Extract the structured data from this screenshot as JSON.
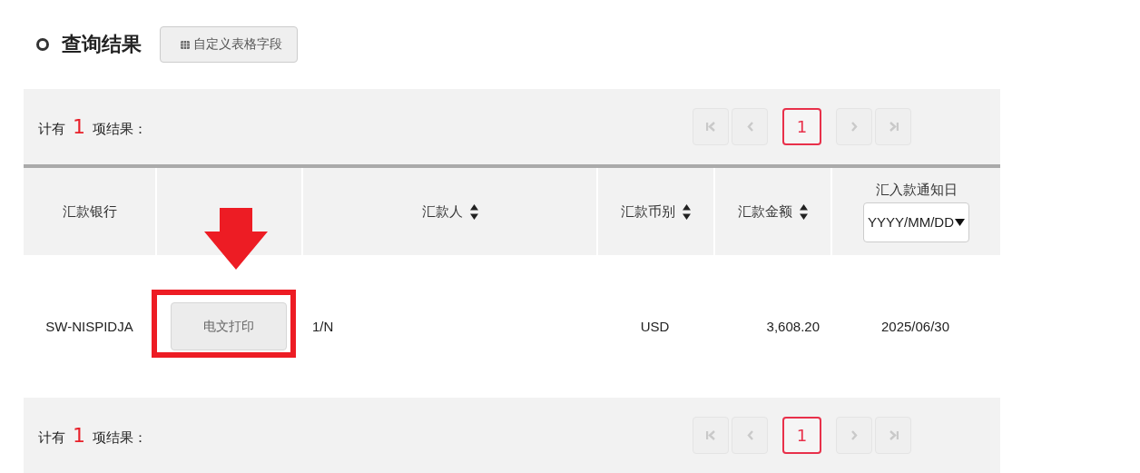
{
  "heading": {
    "title": "查询结果",
    "custom_button": "自定义表格字段"
  },
  "top_bar": {
    "prefix": "计有",
    "count": "1",
    "suffix": "项结果：",
    "pager": [
      {
        "kind": "first",
        "disabled": true
      },
      {
        "kind": "prev",
        "disabled": true
      },
      {
        "kind": "page",
        "label": "1",
        "selected": true
      },
      {
        "kind": "next",
        "disabled": true
      },
      {
        "kind": "last",
        "disabled": true
      }
    ]
  },
  "table": {
    "columns": [
      {
        "label": "汇款银行"
      },
      {},
      {
        "label": "汇款人",
        "sortable": true
      },
      {
        "label": "汇款币别",
        "sortable": true
      },
      {
        "label": "汇款金额",
        "sortable": true
      },
      {
        "label": "汇入款通知日",
        "filter_placeholder": "YYYY/MM/DD"
      }
    ],
    "rows": [
      {
        "cells": [
          {
            "kind": "text",
            "text": "SW-NISPIDJA"
          },
          {
            "kind": "button",
            "text": "电文打印",
            "highlighted": true
          },
          {
            "kind": "text",
            "text": "1/N"
          },
          {
            "kind": "text",
            "text": "USD"
          },
          {
            "kind": "text",
            "text": "3,608.20"
          },
          {
            "kind": "text",
            "text": "2025/06/30"
          }
        ]
      }
    ]
  },
  "bottom_bar": {
    "prefix": "计有",
    "count": "1",
    "suffix": "项结果：",
    "pager": [
      {
        "kind": "first",
        "disabled": true
      },
      {
        "kind": "prev",
        "disabled": true
      },
      {
        "kind": "page",
        "label": "1",
        "selected": true
      },
      {
        "kind": "next",
        "disabled": true
      },
      {
        "kind": "last",
        "disabled": true
      }
    ]
  }
}
